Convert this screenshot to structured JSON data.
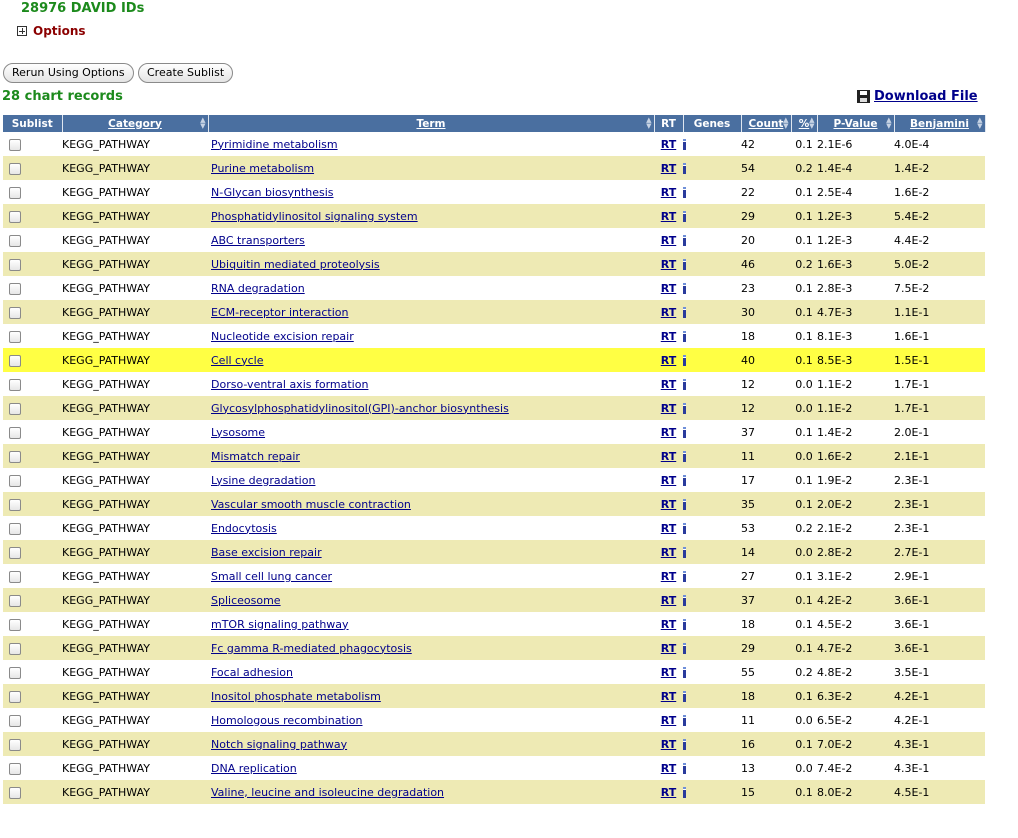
{
  "header": {
    "ids_count": "28976 DAVID IDs",
    "options_label": "Options"
  },
  "buttons": {
    "rerun": "Rerun Using Options",
    "create_sublist": "Create Sublist"
  },
  "records_count": "28 chart records",
  "download_label": "Download File",
  "columns": {
    "sublist": "Sublist",
    "category": "Category",
    "term": "Term",
    "rt": "RT",
    "genes": "Genes",
    "count": "Count",
    "percent": "%",
    "pvalue": "P-Value",
    "benjamini": "Benjamini"
  },
  "highlight_row_index": 9,
  "rows": [
    {
      "category": "KEGG_PATHWAY",
      "term": "Pyrimidine metabolism",
      "rt": "RT",
      "count": "42",
      "percent": "0.1",
      "pvalue": "2.1E-6",
      "benjamini": "4.0E-4"
    },
    {
      "category": "KEGG_PATHWAY",
      "term": "Purine metabolism",
      "rt": "RT",
      "count": "54",
      "percent": "0.2",
      "pvalue": "1.4E-4",
      "benjamini": "1.4E-2"
    },
    {
      "category": "KEGG_PATHWAY",
      "term": "N-Glycan biosynthesis",
      "rt": "RT",
      "count": "22",
      "percent": "0.1",
      "pvalue": "2.5E-4",
      "benjamini": "1.6E-2"
    },
    {
      "category": "KEGG_PATHWAY",
      "term": "Phosphatidylinositol signaling system",
      "rt": "RT",
      "count": "29",
      "percent": "0.1",
      "pvalue": "1.2E-3",
      "benjamini": "5.4E-2"
    },
    {
      "category": "KEGG_PATHWAY",
      "term": "ABC transporters",
      "rt": "RT",
      "count": "20",
      "percent": "0.1",
      "pvalue": "1.2E-3",
      "benjamini": "4.4E-2"
    },
    {
      "category": "KEGG_PATHWAY",
      "term": "Ubiquitin mediated proteolysis",
      "rt": "RT",
      "count": "46",
      "percent": "0.2",
      "pvalue": "1.6E-3",
      "benjamini": "5.0E-2"
    },
    {
      "category": "KEGG_PATHWAY",
      "term": "RNA degradation",
      "rt": "RT",
      "count": "23",
      "percent": "0.1",
      "pvalue": "2.8E-3",
      "benjamini": "7.5E-2"
    },
    {
      "category": "KEGG_PATHWAY",
      "term": "ECM-receptor interaction",
      "rt": "RT",
      "count": "30",
      "percent": "0.1",
      "pvalue": "4.7E-3",
      "benjamini": "1.1E-1"
    },
    {
      "category": "KEGG_PATHWAY",
      "term": "Nucleotide excision repair",
      "rt": "RT",
      "count": "18",
      "percent": "0.1",
      "pvalue": "8.1E-3",
      "benjamini": "1.6E-1"
    },
    {
      "category": "KEGG_PATHWAY",
      "term": "Cell cycle",
      "rt": "RT",
      "count": "40",
      "percent": "0.1",
      "pvalue": "8.5E-3",
      "benjamini": "1.5E-1"
    },
    {
      "category": "KEGG_PATHWAY",
      "term": "Dorso-ventral axis formation",
      "rt": "RT",
      "count": "12",
      "percent": "0.0",
      "pvalue": "1.1E-2",
      "benjamini": "1.7E-1"
    },
    {
      "category": "KEGG_PATHWAY",
      "term": "Glycosylphosphatidylinositol(GPI)-anchor biosynthesis",
      "rt": "RT",
      "count": "12",
      "percent": "0.0",
      "pvalue": "1.1E-2",
      "benjamini": "1.7E-1"
    },
    {
      "category": "KEGG_PATHWAY",
      "term": "Lysosome",
      "rt": "RT",
      "count": "37",
      "percent": "0.1",
      "pvalue": "1.4E-2",
      "benjamini": "2.0E-1"
    },
    {
      "category": "KEGG_PATHWAY",
      "term": "Mismatch repair",
      "rt": "RT",
      "count": "11",
      "percent": "0.0",
      "pvalue": "1.6E-2",
      "benjamini": "2.1E-1"
    },
    {
      "category": "KEGG_PATHWAY",
      "term": "Lysine degradation",
      "rt": "RT",
      "count": "17",
      "percent": "0.1",
      "pvalue": "1.9E-2",
      "benjamini": "2.3E-1"
    },
    {
      "category": "KEGG_PATHWAY",
      "term": "Vascular smooth muscle contraction",
      "rt": "RT",
      "count": "35",
      "percent": "0.1",
      "pvalue": "2.0E-2",
      "benjamini": "2.3E-1"
    },
    {
      "category": "KEGG_PATHWAY",
      "term": "Endocytosis",
      "rt": "RT",
      "count": "53",
      "percent": "0.2",
      "pvalue": "2.1E-2",
      "benjamini": "2.3E-1"
    },
    {
      "category": "KEGG_PATHWAY",
      "term": "Base excision repair",
      "rt": "RT",
      "count": "14",
      "percent": "0.0",
      "pvalue": "2.8E-2",
      "benjamini": "2.7E-1"
    },
    {
      "category": "KEGG_PATHWAY",
      "term": "Small cell lung cancer",
      "rt": "RT",
      "count": "27",
      "percent": "0.1",
      "pvalue": "3.1E-2",
      "benjamini": "2.9E-1"
    },
    {
      "category": "KEGG_PATHWAY",
      "term": "Spliceosome",
      "rt": "RT",
      "count": "37",
      "percent": "0.1",
      "pvalue": "4.2E-2",
      "benjamini": "3.6E-1"
    },
    {
      "category": "KEGG_PATHWAY",
      "term": "mTOR signaling pathway",
      "rt": "RT",
      "count": "18",
      "percent": "0.1",
      "pvalue": "4.5E-2",
      "benjamini": "3.6E-1"
    },
    {
      "category": "KEGG_PATHWAY",
      "term": "Fc gamma R-mediated phagocytosis",
      "rt": "RT",
      "count": "29",
      "percent": "0.1",
      "pvalue": "4.7E-2",
      "benjamini": "3.6E-1"
    },
    {
      "category": "KEGG_PATHWAY",
      "term": "Focal adhesion",
      "rt": "RT",
      "count": "55",
      "percent": "0.2",
      "pvalue": "4.8E-2",
      "benjamini": "3.5E-1"
    },
    {
      "category": "KEGG_PATHWAY",
      "term": "Inositol phosphate metabolism",
      "rt": "RT",
      "count": "18",
      "percent": "0.1",
      "pvalue": "6.3E-2",
      "benjamini": "4.2E-1"
    },
    {
      "category": "KEGG_PATHWAY",
      "term": "Homologous recombination",
      "rt": "RT",
      "count": "11",
      "percent": "0.0",
      "pvalue": "6.5E-2",
      "benjamini": "4.2E-1"
    },
    {
      "category": "KEGG_PATHWAY",
      "term": "Notch signaling pathway",
      "rt": "RT",
      "count": "16",
      "percent": "0.1",
      "pvalue": "7.0E-2",
      "benjamini": "4.3E-1"
    },
    {
      "category": "KEGG_PATHWAY",
      "term": "DNA replication",
      "rt": "RT",
      "count": "13",
      "percent": "0.0",
      "pvalue": "7.4E-2",
      "benjamini": "4.3E-1"
    },
    {
      "category": "KEGG_PATHWAY",
      "term": "Valine, leucine and isoleucine degradation",
      "rt": "RT",
      "count": "15",
      "percent": "0.1",
      "pvalue": "8.0E-2",
      "benjamini": "4.5E-1"
    }
  ],
  "icons": {
    "options_toggle": "plus-box-icon",
    "download": "floppy-disk-icon",
    "genes": "gene-list-icon",
    "sort": "sort-arrows-icon"
  },
  "colors": {
    "header_bg": "#4a6fa0",
    "row_even": "#eeeab4",
    "row_highlight": "#ffff44",
    "green_text": "#1c8a1c",
    "options_text": "#8b0000",
    "link": "#00008b"
  }
}
